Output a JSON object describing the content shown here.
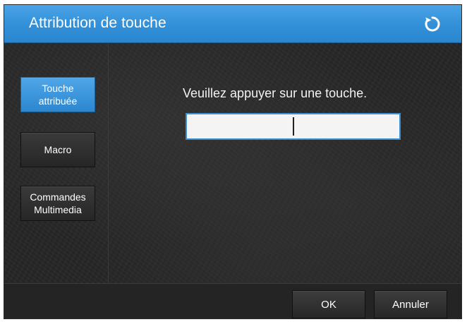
{
  "window": {
    "title": "Attribution de touche",
    "refresh_icon": "refresh-icon"
  },
  "sidebar": {
    "items": [
      {
        "label": "Touche\nattribuée",
        "active": true
      },
      {
        "label": "Macro",
        "active": false
      },
      {
        "label": "Commandes\nMultimedia",
        "active": false
      }
    ]
  },
  "main": {
    "prompt": "Veuillez appuyer sur une touche.",
    "key_input": {
      "value": "",
      "placeholder": ""
    }
  },
  "footer": {
    "ok_label": "OK",
    "cancel_label": "Annuler"
  },
  "colors": {
    "accent": "#3290d8",
    "background": "#262626",
    "button": "#2e2e2e",
    "text": "#ffffff"
  }
}
